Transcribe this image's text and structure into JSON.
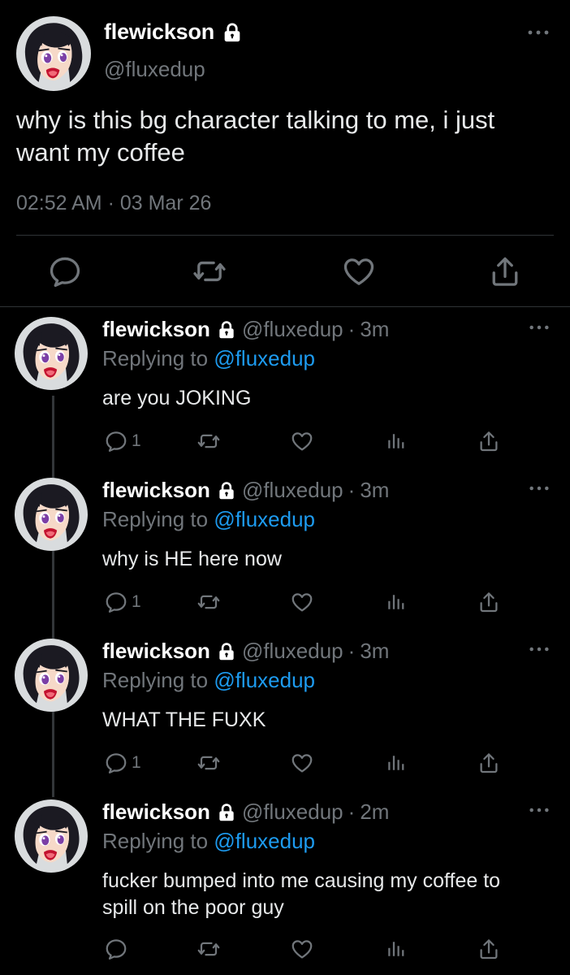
{
  "main_tweet": {
    "name": "flewickson",
    "handle": "@fluxedup",
    "text": "why is this bg character talking to me, i just want my coffee",
    "timestamp": "02:52 AM · 03 Mar 26",
    "icons": [
      "avatar",
      "lock-icon",
      "more-icon",
      "reply-icon",
      "retweet-icon",
      "like-icon",
      "share-icon"
    ]
  },
  "replies": [
    {
      "name": "flewickson",
      "handle": "@fluxedup",
      "time": "3m",
      "replying_prefix": "Replying to",
      "replying_to": "@fluxedup",
      "text": "are you JOKING",
      "reply_count": "1"
    },
    {
      "name": "flewickson",
      "handle": "@fluxedup",
      "time": "3m",
      "replying_prefix": "Replying to",
      "replying_to": "@fluxedup",
      "text": "why is HE here now",
      "reply_count": "1"
    },
    {
      "name": "flewickson",
      "handle": "@fluxedup",
      "time": "3m",
      "replying_prefix": "Replying to",
      "replying_to": "@fluxedup",
      "text": "WHAT THE FUXK",
      "reply_count": "1"
    },
    {
      "name": "flewickson",
      "handle": "@fluxedup",
      "time": "2m",
      "replying_prefix": "Replying to",
      "replying_to": "@fluxedup",
      "text": "fucker bumped into me causing my coffee to spill on the poor guy",
      "reply_count": ""
    }
  ],
  "colors": {
    "background": "#000000",
    "text": "#e7e9ea",
    "muted": "#71767b",
    "link": "#1d9bf0",
    "divider": "#2f3336"
  }
}
